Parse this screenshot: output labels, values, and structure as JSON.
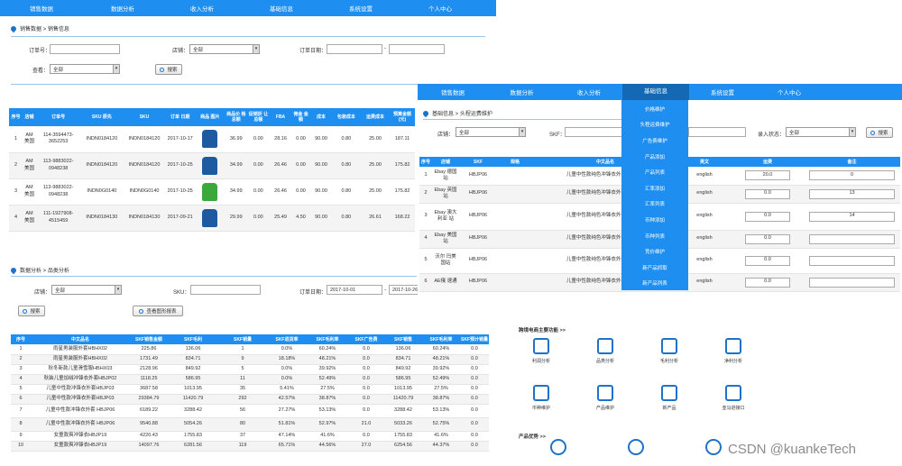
{
  "nav1": [
    "销售数据",
    "数据分析",
    "收入分析",
    "基础信息",
    "系统设置",
    "个人中心"
  ],
  "p1": {
    "crumb": "销售数据 > 销售信息",
    "order_label": "订单号：",
    "shop_label": "店铺：",
    "shop_value": "全部",
    "date_label": "订单日期：",
    "view_label": "查看：",
    "view_value": "全部",
    "search_btn": "搜索",
    "headers": [
      "序号",
      "店铺",
      "订单号",
      "SKU 原先",
      "SKU",
      "订单 日期",
      "商品 图片",
      "商品价 格总额",
      "促销折 让总额",
      "FBA",
      "佣金 金额",
      "成本",
      "包装成本",
      "运费成本",
      "预算金额 (元)"
    ],
    "rows": [
      [
        "1",
        "AM 美国",
        "114-3594473-3652253",
        "INDN0184120",
        "INDN0184120",
        "2017-10-17",
        "#1e5aa0",
        "36.99",
        "0.00",
        "28.16",
        "0.00",
        "90.00",
        "0.80",
        "25.00",
        "187.11"
      ],
      [
        "2",
        "AM 美国",
        "113-9883022-0948238",
        "INDN0184120",
        "INDN0184120",
        "2017-10-25",
        "#1e5aa0",
        "34.99",
        "0.00",
        "26.46",
        "0.00",
        "90.00",
        "0.80",
        "25.00",
        "175.82"
      ],
      [
        "3",
        "AM 美国",
        "113-9883022-0948238",
        "INDN0G0140",
        "INDN0G0140",
        "2017-10-25",
        "#3aa83a",
        "34.99",
        "0.00",
        "26.46",
        "0.00",
        "90.00",
        "0.80",
        "25.00",
        "175.82"
      ],
      [
        "4",
        "AM 美国",
        "111-1927908-4515459",
        "INDN0184130",
        "INDN0184130",
        "2017-09-21",
        "#1e5aa0",
        "29.99",
        "0.00",
        "25.49",
        "4.50",
        "90.00",
        "0.80",
        "26.61",
        "168.22"
      ]
    ]
  },
  "p2": {
    "crumb": "数据分析 > 品类分析",
    "shop_label": "店铺：",
    "shop_value": "全部",
    "sku_label": "SKU：",
    "date_label": "订单日期：",
    "date_from": "2017-10-01",
    "date_sep": "-",
    "date_to": "2017-10-26",
    "search_btn": "搜索",
    "chart_btn": "查看图形报表",
    "headers": [
      "序号",
      "中文品名",
      "SKF销售金额",
      "SKF毛利",
      "SKF销量",
      "SKF退货率",
      "SKF毛利率",
      "SKF广告费",
      "SKF销售",
      "SKF毛利率",
      "SKF预计销量"
    ],
    "rows": [
      [
        "1",
        "雨星男装服外套HBHX02",
        "225.86",
        "136.06",
        "1",
        "0.0%",
        "60.24%",
        "0.0",
        "136.06",
        "60.24%",
        "0.0"
      ],
      [
        "2",
        "雨星男装服外套HBHX02",
        "1731.49",
        "834.71",
        "9",
        "18.18%",
        "48.21%",
        "0.0",
        "834.71",
        "48.21%",
        "0.0"
      ],
      [
        "3",
        "秋冬新款儿童滑雪服HBHX03",
        "2128.96",
        "849.92",
        "5",
        "0.0%",
        "39.92%",
        "0.0",
        "849.92",
        "39.92%",
        "0.0"
      ],
      [
        "4",
        "秋装儿童加绒冲锋衣外套HBJP02",
        "1118.25",
        "586.95",
        "11",
        "0.0%",
        "52.49%",
        "0.0",
        "586.95",
        "52.49%",
        "0.0"
      ],
      [
        "5",
        "儿童中性款冲锋衣外套HBJP03",
        "3687.58",
        "1013.95",
        "35",
        "5.41%",
        "27.5%",
        "0.0",
        "1013.95",
        "27.5%",
        "0.0"
      ],
      [
        "6",
        "儿童中性款冲锋衣外套HBJP03",
        "29384.79",
        "11420.79",
        "292",
        "42.57%",
        "38.87%",
        "0.0",
        "11420.79",
        "38.87%",
        "0.0"
      ],
      [
        "7",
        "儿童中性款冲锋衣外套 HBJP06",
        "6189.22",
        "3288.42",
        "56",
        "27.27%",
        "53.13%",
        "0.0",
        "3288.42",
        "53.13%",
        "0.0"
      ],
      [
        "8",
        "儿童中性款冲锋衣外套 HBJP06",
        "9540.88",
        "5054.26",
        "80",
        "51.81%",
        "52.97%",
        "21.0",
        "5033.26",
        "52.75%",
        "0.0"
      ],
      [
        "9",
        "女童款爽冲锋衣HBJP19",
        "4220.43",
        "1755.83",
        "37",
        "47.14%",
        "41.6%",
        "0.0",
        "1755.83",
        "41.6%",
        "0.0"
      ],
      [
        "10",
        "女童款爽冲锋衣HBJP19",
        "14097.76",
        "6281.56",
        "119",
        "65.71%",
        "44.56%",
        "27.0",
        "6254.56",
        "44.37%",
        "0.0"
      ]
    ]
  },
  "nav2": [
    "销售数据",
    "数据分析",
    "收入分析",
    "基础信息",
    "系统设置",
    "个人中心"
  ],
  "p3": {
    "crumb": "基础信息 > 头程运费维护",
    "shop_label": "店铺：",
    "shop_value": "全部",
    "skf_label": "SKF：",
    "state_label": "录入状态：",
    "state_value": "全部",
    "search_btn": "搜索",
    "headers": [
      "序号",
      "店铺",
      "SKF",
      "规格",
      "中文品名",
      "英文",
      "运费",
      "备注"
    ],
    "rows": [
      [
        "1",
        "Ebay 德国 站",
        "HBJP06",
        "",
        "儿童中性款纯色冲锋衣外套HBJP06",
        "english",
        "20.0",
        "0"
      ],
      [
        "2",
        "Ebay 英国 站",
        "HBJP06",
        "",
        "儿童中性款纯色冲锋衣外套HBJP06",
        "english",
        "0.0",
        "13"
      ],
      [
        "3",
        "Ebay 澳大 利亚 站",
        "HBJP06",
        "",
        "儿童中性款纯色冲锋衣外套HBJP06",
        "english",
        "0.0",
        "14"
      ],
      [
        "4",
        "Ebay 美国 站",
        "HBJP06",
        "",
        "儿童中性款纯色冲锋衣外套HBJP06",
        "english",
        "0.0",
        ""
      ],
      [
        "5",
        "沃尔 玛美 国站",
        "HBJP06",
        "",
        "儿童中性款纯色冲锋衣外套HBJP06",
        "english",
        "0.0",
        ""
      ],
      [
        "6",
        "AE俄 速通",
        "HBJP06",
        "",
        "儿童中性款纯色冲锋衣外套HBJP06",
        "english",
        "0.0",
        ""
      ]
    ]
  },
  "dropdown": [
    "价格维护",
    "头程运费维护",
    "广告费维护",
    "产品添加",
    "产品列表",
    "汇率添加",
    "汇率列表",
    "币种添加",
    "币种列表",
    "竞价维护",
    "新产品抓取",
    "新产品列表"
  ],
  "features": {
    "title1": "跨境电商主要功能 >>",
    "items": [
      {
        "label": "利润分析",
        "icon": "report-icon"
      },
      {
        "label": "品类分析",
        "icon": "chart-icon"
      },
      {
        "label": "毛利分析",
        "icon": "yen-icon"
      },
      {
        "label": "净利分析",
        "icon": "document-icon"
      },
      {
        "label": "币种维护",
        "icon": "currency-icon"
      },
      {
        "label": "产品维护",
        "icon": "download-icon"
      },
      {
        "label": "新产品",
        "icon": "alarm-icon"
      },
      {
        "label": "亚马逊接口",
        "icon": "bar-chart-icon"
      }
    ],
    "title2": "产品优势 >>",
    "items2": [
      {
        "label": "",
        "icon": "support-icon"
      },
      {
        "label": "",
        "icon": "shield-icon"
      },
      {
        "label": "",
        "icon": "check-icon"
      }
    ]
  },
  "watermark": "CSDN @kuankeTech",
  "colors": {
    "primary": "#1e8ff0",
    "dark": "#1e73c8"
  }
}
